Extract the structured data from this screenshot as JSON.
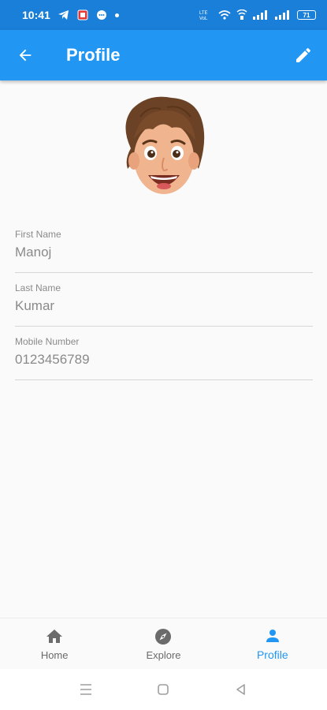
{
  "status_bar": {
    "time": "10:41",
    "battery": "71",
    "network": "4G"
  },
  "app_bar": {
    "title": "Profile"
  },
  "profile": {
    "fields": [
      {
        "label": "First Name",
        "value": "Manoj"
      },
      {
        "label": "Last Name",
        "value": "Kumar"
      },
      {
        "label": "Mobile Number",
        "value": "0123456789"
      }
    ]
  },
  "bottom_nav": {
    "items": [
      {
        "label": "Home",
        "icon": "home-icon",
        "active": false
      },
      {
        "label": "Explore",
        "icon": "compass-icon",
        "active": false
      },
      {
        "label": "Profile",
        "icon": "person-icon",
        "active": true
      }
    ]
  },
  "colors": {
    "primary": "#2196f3",
    "status_bar": "#1a7fd8",
    "inactive": "#6b6b6b"
  }
}
